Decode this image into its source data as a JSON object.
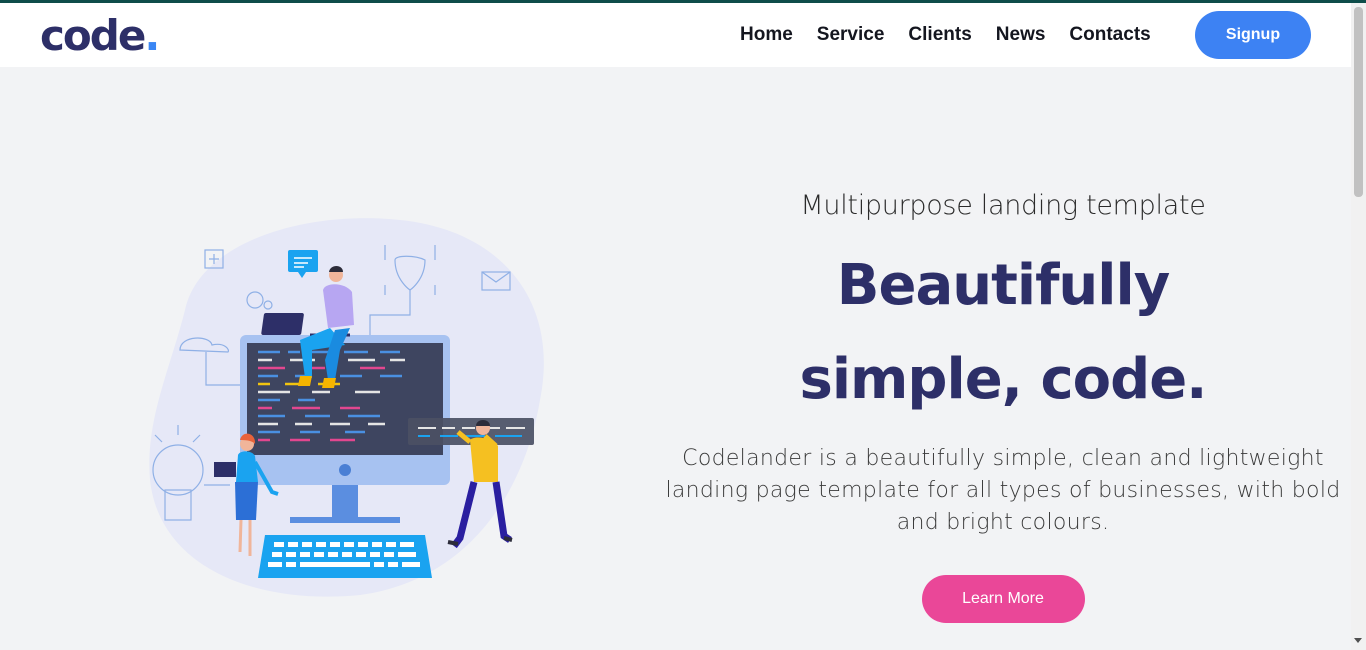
{
  "header": {
    "logo_text": "code",
    "logo_dot": ".",
    "nav": [
      {
        "label": "Home"
      },
      {
        "label": "Service"
      },
      {
        "label": "Clients"
      },
      {
        "label": "News"
      },
      {
        "label": "Contacts"
      }
    ],
    "signup_label": "Signup"
  },
  "hero": {
    "eyebrow": "Multipurpose landing template",
    "headline_line1": "Beautifully",
    "headline_line2": "simple, code.",
    "description": "Codelander is a beautifully simple, clean and lightweight landing page template for all types of businesses, with bold and bright colours.",
    "cta_label": "Learn More"
  },
  "colors": {
    "brand_navy": "#2d2f68",
    "signup_blue": "#3d82f3",
    "cta_pink": "#ea4798",
    "page_bg": "#f2f3f5"
  }
}
